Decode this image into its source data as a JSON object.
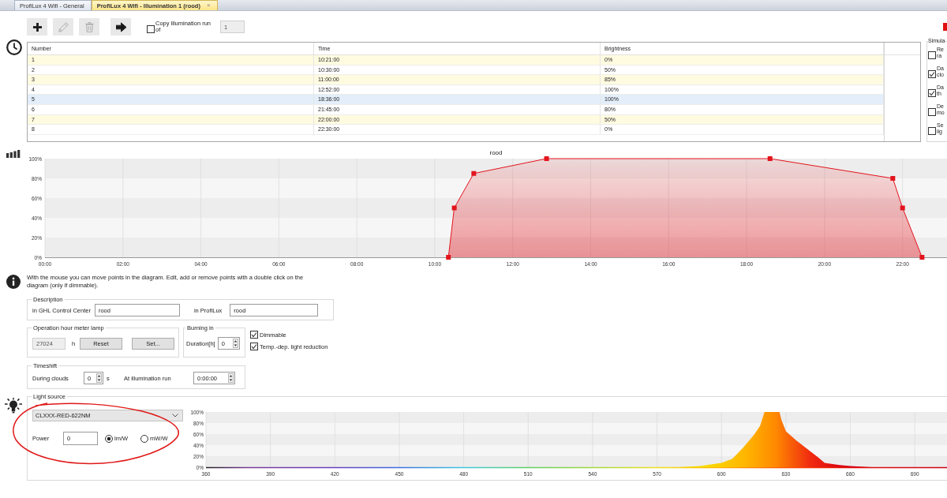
{
  "tabs": [
    {
      "label": "ProfiLux 4 Wifi - General",
      "selected": false
    },
    {
      "label": "ProfiLux 4 Wifi - Illumination 1 (rood)",
      "selected": true,
      "close": "×"
    }
  ],
  "toolbar": {
    "buttons": [
      {
        "kind": "add",
        "disabled": false
      },
      {
        "kind": "edit",
        "disabled": true
      },
      {
        "kind": "delete",
        "disabled": true
      },
      {
        "kind": "apply",
        "disabled": false
      }
    ],
    "copy": {
      "label": "Copy illumination run of",
      "checked": false,
      "field": {
        "text": "1",
        "disabled": true
      }
    }
  },
  "table": {
    "columns": [
      "Number",
      "Time",
      "Brightness"
    ],
    "rows": [
      {
        "cells": [
          "1",
          "10:21:00",
          "0%"
        ],
        "selected": false
      },
      {
        "cells": [
          "2",
          "10:30:00",
          "50%"
        ],
        "selected": false
      },
      {
        "cells": [
          "3",
          "11:00:00",
          "85%"
        ],
        "selected": false
      },
      {
        "cells": [
          "4",
          "12:52:00",
          "100%"
        ],
        "selected": false
      },
      {
        "cells": [
          "5",
          "18:36:00",
          "100%"
        ],
        "selected": true
      },
      {
        "cells": [
          "6",
          "21:45:00",
          "80%"
        ],
        "selected": false
      },
      {
        "cells": [
          "7",
          "22:00:00",
          "50%"
        ],
        "selected": false
      },
      {
        "cells": [
          "8",
          "22:30:00",
          "0%"
        ],
        "selected": false
      }
    ]
  },
  "simulation": {
    "title": "Simula",
    "options": [
      {
        "label": "Re ra",
        "checked": false
      },
      {
        "label": "Da clo",
        "checked": true
      },
      {
        "label": "Da th",
        "checked": true
      },
      {
        "label": "De mo",
        "checked": false
      },
      {
        "label": "Se lig",
        "checked": false
      }
    ]
  },
  "chart": {
    "chart_data": {
      "type": "area",
      "title": "rood",
      "x": [
        10.35,
        10.5,
        11,
        12.867,
        18.6,
        21.75,
        22,
        22.5
      ],
      "series": [
        {
          "color": "#e3141c",
          "values": [
            0,
            50,
            85,
            100,
            100,
            80,
            50,
            0
          ]
        }
      ],
      "xlim": [
        0,
        23.14
      ],
      "ylim": [
        0,
        100
      ],
      "xticks": [
        {
          "value": 0,
          "label": "00:00"
        },
        {
          "value": 2,
          "label": "02:00"
        },
        {
          "value": 4,
          "label": "04:00"
        },
        {
          "value": 6,
          "label": "06:00"
        },
        {
          "value": 8,
          "label": "08:00"
        },
        {
          "value": 10,
          "label": "10:00"
        },
        {
          "value": 12,
          "label": "12:00"
        },
        {
          "value": 14,
          "label": "14:00"
        },
        {
          "value": 16,
          "label": "16:00"
        },
        {
          "value": 18,
          "label": "18:00"
        },
        {
          "value": 20,
          "label": "20:00"
        },
        {
          "value": 22,
          "label": "22:00"
        }
      ],
      "yticks": [
        {
          "value": 0,
          "label": "0%"
        },
        {
          "value": 20,
          "label": "20%"
        },
        {
          "value": 40,
          "label": "40%"
        },
        {
          "value": 60,
          "label": "60%"
        },
        {
          "value": 80,
          "label": "80%"
        },
        {
          "value": 100,
          "label": "100%"
        }
      ],
      "grid": true
    }
  },
  "info": {
    "text": "With the mouse you can move points in the diagram. Edit, add or remove points with a double click on the diagram (only if dimmable)."
  },
  "description": {
    "title": "Description",
    "ghl_label": "in GHL Control Center",
    "ghl_value": "rood",
    "profilux_label": "in ProfiLux",
    "profilux_value": "rood"
  },
  "operation_hours": {
    "title": "Operation hour meter lamp",
    "counter": {
      "text": "27024",
      "disabled": true
    },
    "unit": "h",
    "buttons": [
      "Reset",
      "Set..."
    ]
  },
  "burning_in": {
    "title": "Burning in",
    "label": "Duration[h]",
    "value": "0"
  },
  "options": [
    {
      "label": "Dimmable",
      "checked": true
    },
    {
      "label": "Temp.-dep. light reduction",
      "checked": true
    }
  ],
  "timeshift": {
    "title": "Timeshift",
    "clouds_label": "During clouds",
    "clouds_value": "0",
    "clouds_unit": "s",
    "run_label": "At illumination run",
    "run_value": "0:00:00"
  },
  "light_source": {
    "title": "Light source",
    "selection": "CLXXX-RED-622NM",
    "power_label": "Power",
    "power_value": "0",
    "units": [
      {
        "label": "lm/W",
        "selected": true
      },
      {
        "label": "mW/W",
        "selected": false
      }
    ],
    "chart_data": {
      "type": "area",
      "x": [
        580,
        590,
        600,
        605,
        610,
        615,
        618,
        620,
        627,
        628,
        630,
        635,
        640,
        645,
        648,
        655,
        660,
        665,
        670
      ],
      "values": [
        0,
        2,
        8,
        15,
        35,
        58,
        75,
        100,
        100,
        85,
        65,
        48,
        33,
        18,
        8,
        4,
        2,
        1,
        0
      ],
      "xlim": [
        360,
        705
      ],
      "ylim": [
        0,
        100
      ],
      "xticks": [
        360,
        390,
        420,
        450,
        480,
        510,
        540,
        570,
        600,
        630,
        660,
        690
      ],
      "yticks": [
        {
          "value": 0,
          "label": "0%"
        },
        {
          "value": 20,
          "label": "20%"
        },
        {
          "value": 40,
          "label": "40%"
        },
        {
          "value": 60,
          "label": "60%"
        },
        {
          "value": 80,
          "label": "80%"
        },
        {
          "value": 100,
          "label": "100%"
        }
      ],
      "grid": true
    }
  },
  "markup": {
    "kind": "freehand-ellipse"
  }
}
